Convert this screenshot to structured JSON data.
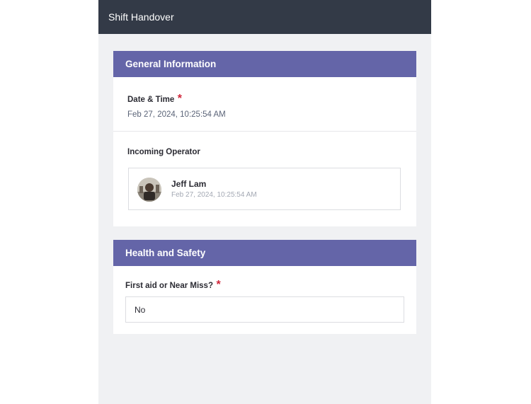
{
  "app": {
    "title": "Shift Handover"
  },
  "general_info": {
    "header": "General Information",
    "date_time": {
      "label": "Date & Time",
      "required_marker": "*",
      "value": "Feb 27, 2024, 10:25:54 AM"
    },
    "incoming_operator": {
      "label": "Incoming Operator",
      "name": "Jeff Lam",
      "timestamp": "Feb 27, 2024, 10:25:54 AM"
    }
  },
  "health_safety": {
    "header": "Health and Safety",
    "first_aid": {
      "label": "First aid or Near Miss?",
      "required_marker": "*",
      "value": "No"
    }
  },
  "colors": {
    "topbar": "#333a47",
    "section_header": "#6465a8",
    "required": "#d0263a",
    "background": "#f0f1f3"
  }
}
